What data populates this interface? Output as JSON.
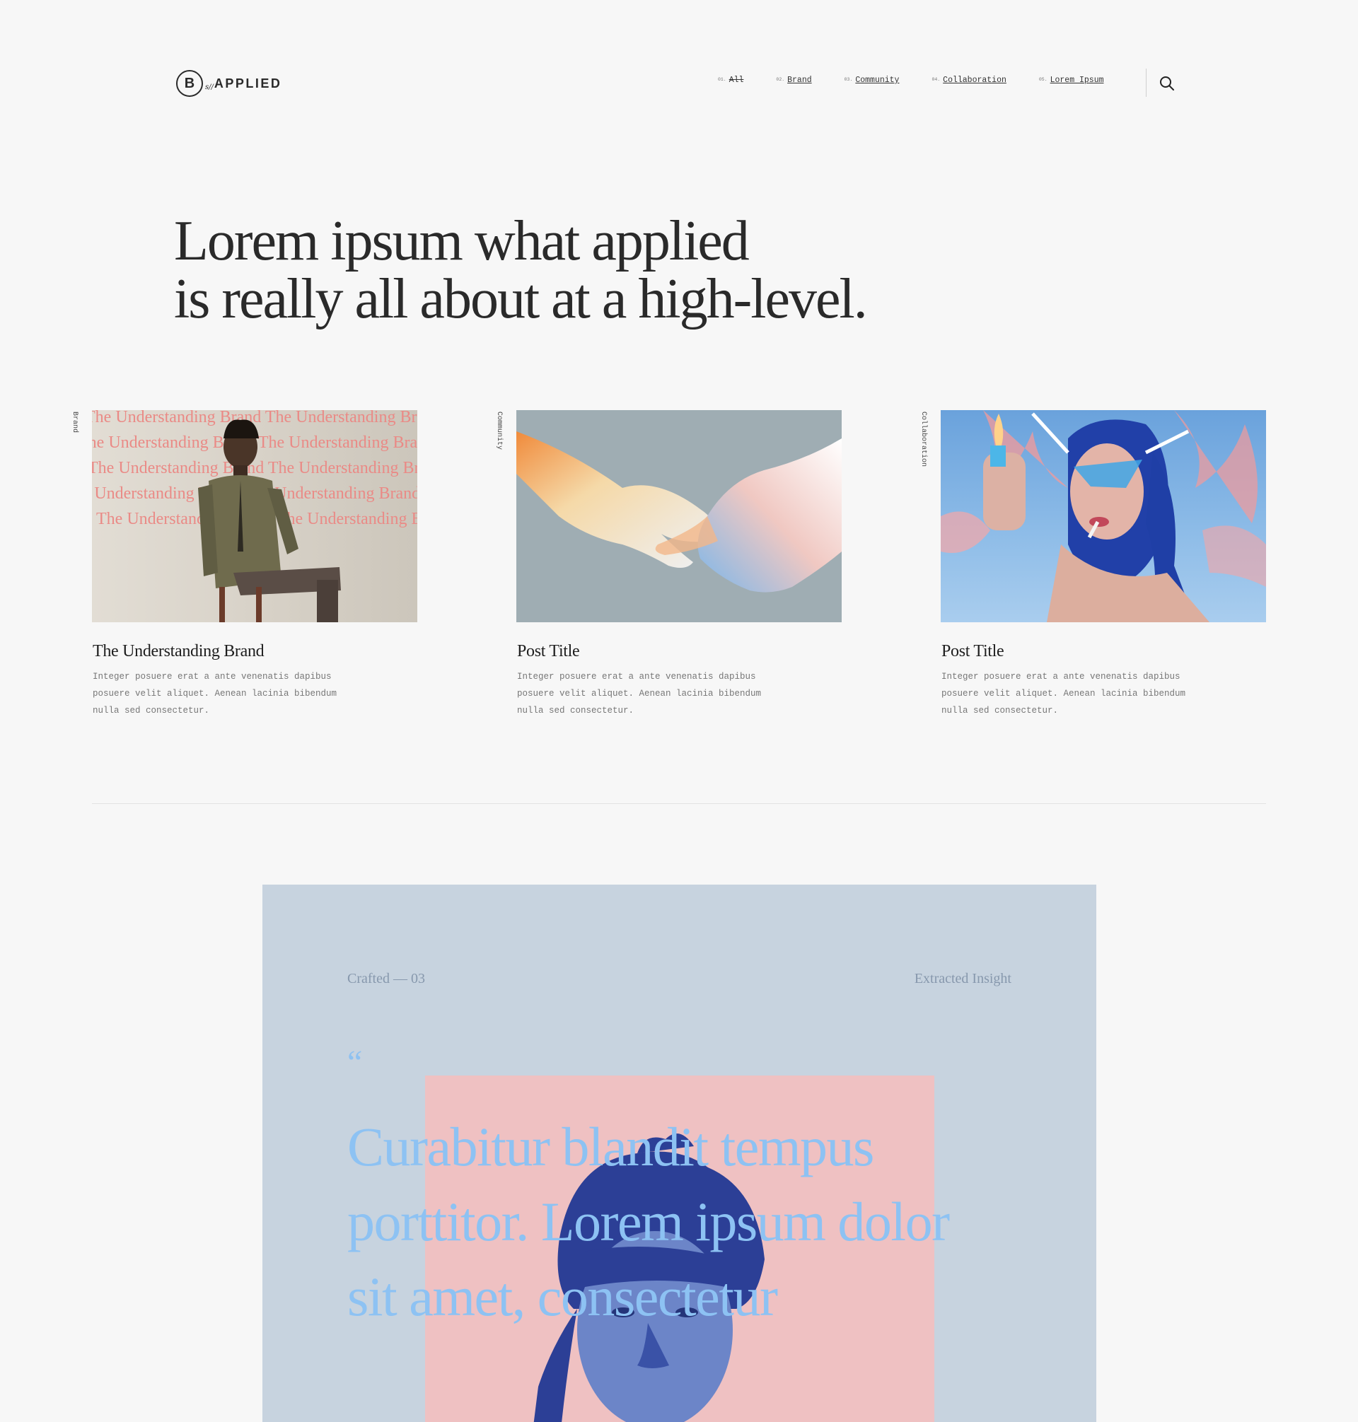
{
  "header": {
    "logo": {
      "pre": "s//",
      "word": "APPLIED",
      "mark": "B"
    },
    "nav": [
      {
        "num": "01.",
        "label": "All"
      },
      {
        "num": "02.",
        "label": "Brand"
      },
      {
        "num": "03.",
        "label": "Community"
      },
      {
        "num": "04.",
        "label": "Collaboration"
      },
      {
        "num": "05.",
        "label": "Lorem Ipsum"
      }
    ],
    "search_icon": "search-icon"
  },
  "hero": {
    "line1": "Lorem ipsum what applied",
    "line2": "is really all about at a high-level."
  },
  "cards": [
    {
      "tag": "Brand",
      "title": "The Understanding Brand",
      "excerpt": "Integer posuere erat a ante venenatis dapibus posuere velit aliquet. Aenean lacinia bibendum nulla sed consectetur.",
      "image_text": "The Understanding Brand The Understanding Brand"
    },
    {
      "tag": "Community",
      "title": "Post Title",
      "excerpt": "Integer posuere erat a ante venenatis dapibus posuere velit aliquet. Aenean lacinia bibendum nulla sed consectetur."
    },
    {
      "tag": "Collaboration",
      "title": "Post Title",
      "excerpt": "Integer posuere erat a ante venenatis dapibus posuere velit aliquet. Aenean lacinia bibendum nulla sed consectetur."
    }
  ],
  "quote": {
    "left_label": "Crafted  — 03",
    "right_label": "Extracted Insight",
    "mark": "“",
    "text": "Curabitur blandit tempus porttitor. Lorem ipsum dolor sit amet, consectetur"
  },
  "colors": {
    "background": "#f7f7f7",
    "quote_bg": "#c7d3df",
    "quote_text": "#8dc2f3",
    "quote_pink": "#efc1c2",
    "brand_overlay_text": "#ea8a86"
  }
}
